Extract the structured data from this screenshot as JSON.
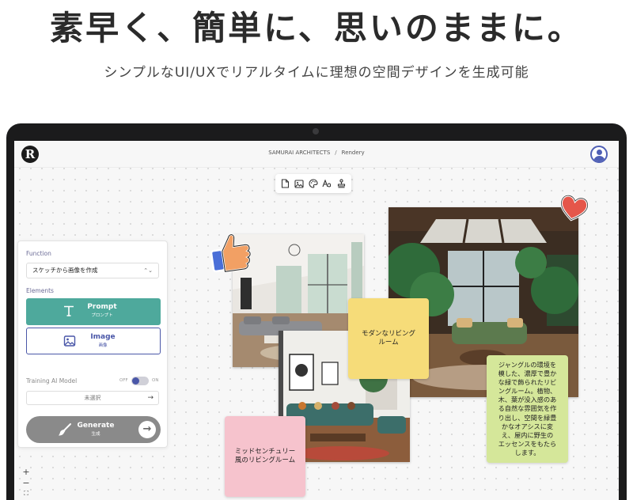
{
  "hero": {
    "title": "素早く、簡単に、思いのままに。",
    "subtitle": "シンプルなUI/UXでリアルタイムに理想の空間デザインを生成可能"
  },
  "app": {
    "breadcrumb": {
      "org": "SAMURAI ARCHITECTS",
      "separator": "/",
      "page": "Rendery"
    },
    "toolbar_icons": [
      "document-icon",
      "image-icon",
      "palette-icon",
      "text-icon",
      "stamp-icon"
    ]
  },
  "panel": {
    "function_label": "Function",
    "function_value": "スケッチから画像を作成",
    "elements_label": "Elements",
    "prompt_button": {
      "label": "Prompt",
      "sublabel": "プロンプト"
    },
    "image_button": {
      "label": "Image",
      "sublabel": "画像"
    },
    "training_label": "Training AI Model",
    "toggle_off": "OFF",
    "toggle_on": "ON",
    "model_value": "未選択",
    "generate_button": {
      "label": "Generate",
      "sublabel": "生成"
    },
    "zoom_in": "+",
    "zoom_out": "−",
    "fit": "⛶"
  },
  "canvas": {
    "sticky_yellow": "モダンなリビング\nルーム",
    "sticky_pink": "ミッドセンチュリー\n風のリビングルーム",
    "sticky_green": "ジャングルの環境を\n模した、濃厚で豊か\nな緑で飾られたリビ\nングルーム。植物、\n木、葉が没入感のあ\nる自然な雰囲気を作\nり出し、空間を緑豊\nかなオアシスに変\nえ、屋内に野生の\nエッセンスをもたら\nします。",
    "reactions": [
      "thumbs-up-icon",
      "heart-icon"
    ]
  },
  "colors": {
    "prompt_teal": "#4ea99c",
    "image_indigo": "#4a57a8",
    "generate_gray": "#8a8a8a",
    "sticky_yellow": "#f6dc79",
    "sticky_pink": "#f6c3cd",
    "sticky_green": "#d5e79a"
  }
}
